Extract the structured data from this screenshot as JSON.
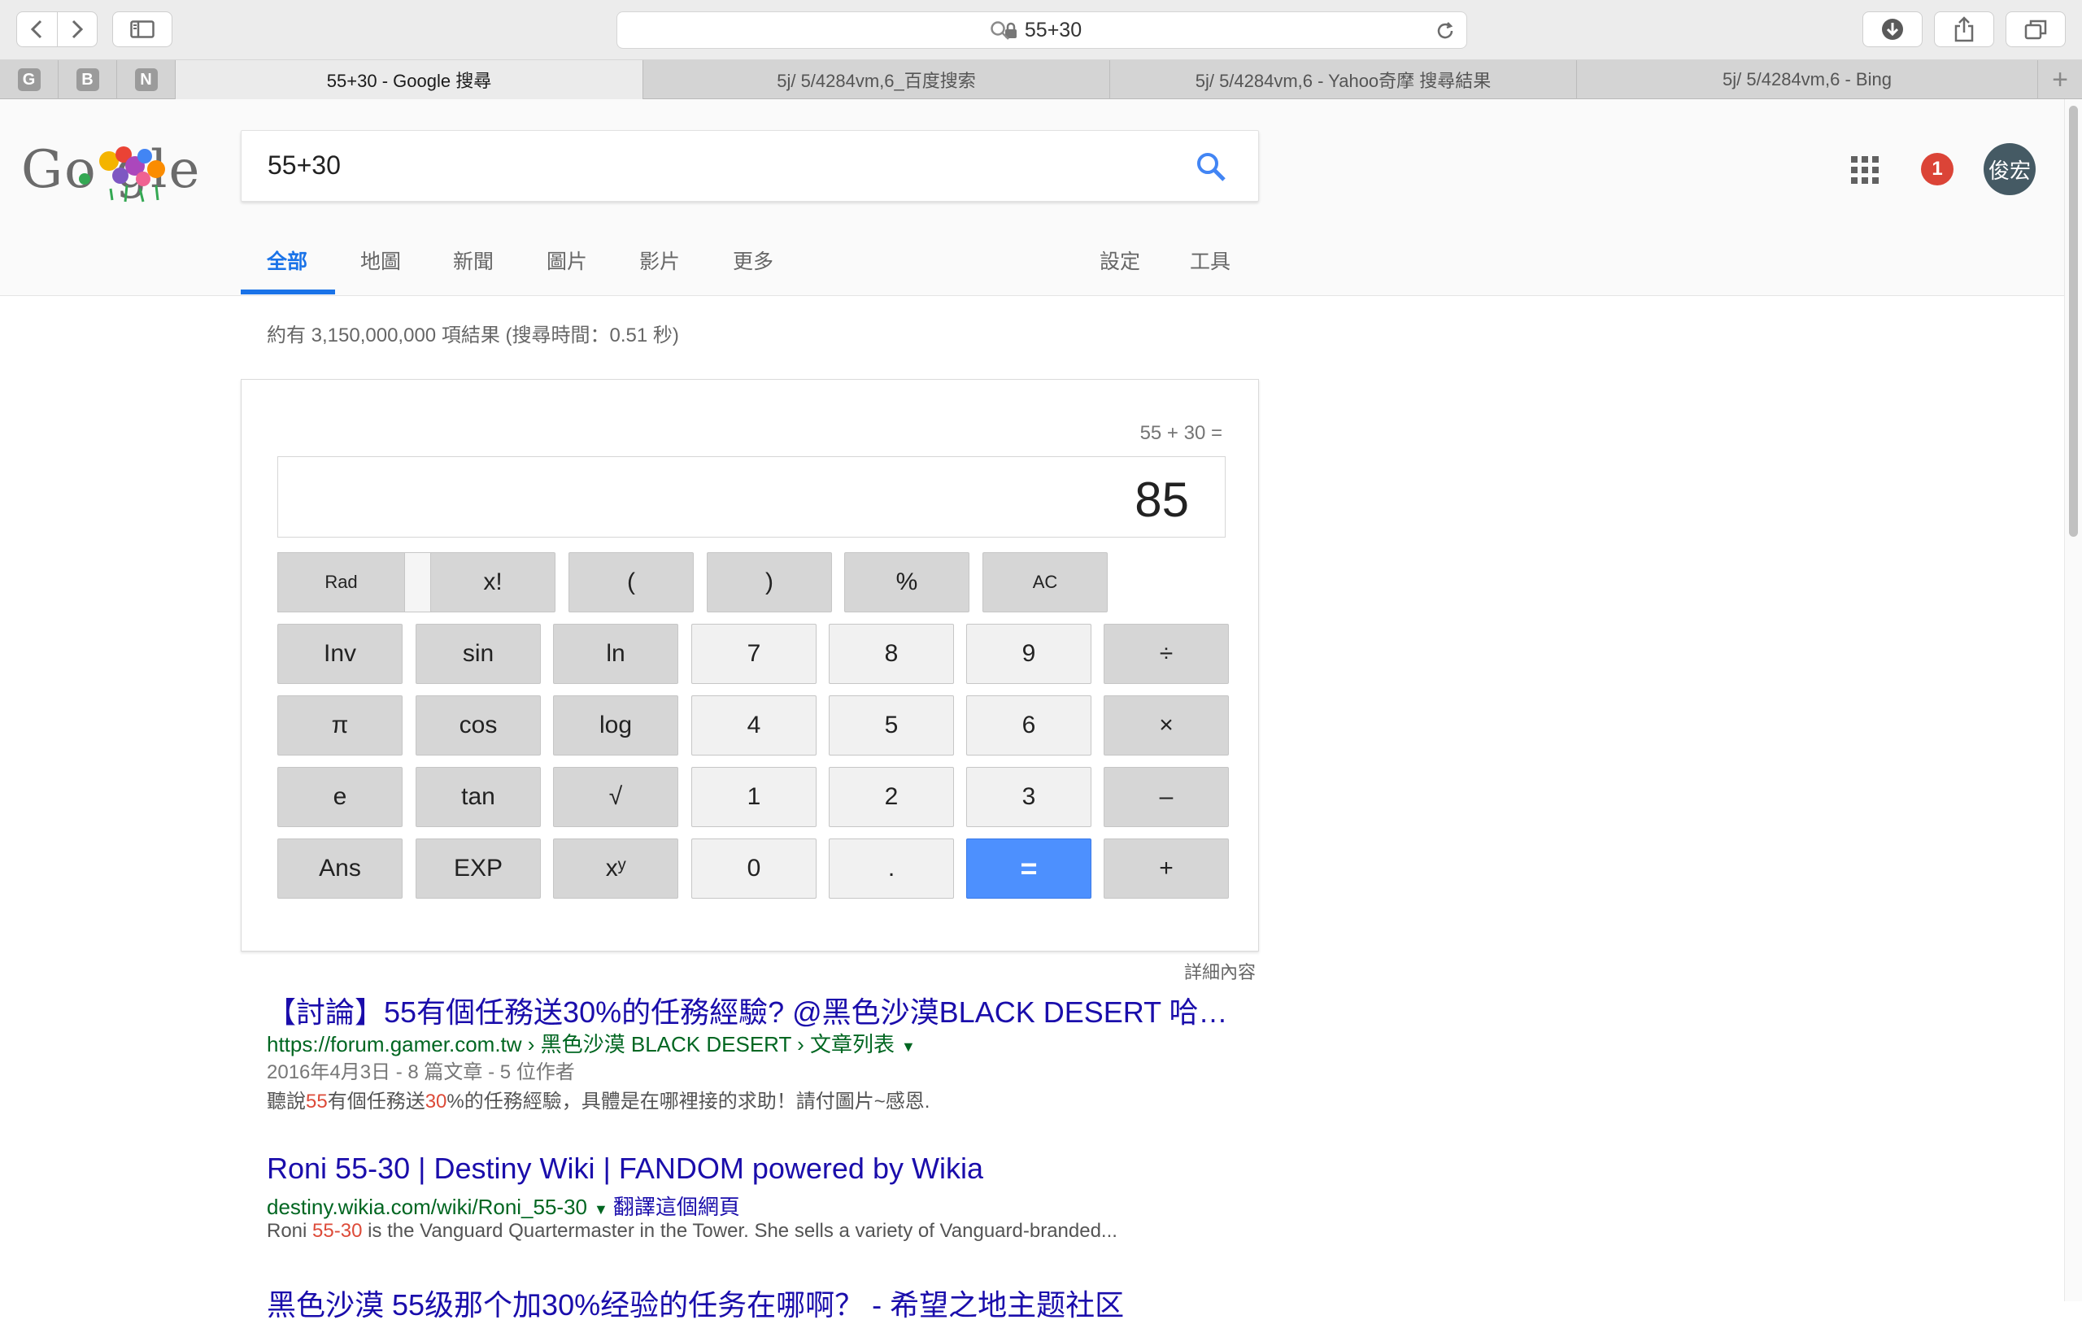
{
  "browser": {
    "url": "55+30",
    "tabs": [
      {
        "label": "55+30 - Google 搜尋",
        "active": true
      },
      {
        "label": "5j/ 5/4284vm,6_百度搜索",
        "active": false
      },
      {
        "label": "5j/ 5/4284vm,6 - Yahoo奇摩 搜尋結果",
        "active": false
      },
      {
        "label": "5j/ 5/4284vm,6 - Bing",
        "active": false
      }
    ],
    "pinned_tabs": [
      "G",
      "B",
      "N"
    ],
    "new_tab_symbol": "+"
  },
  "google": {
    "logo_text": "Go gle",
    "query": "55+30",
    "notification_count": "1",
    "avatar_text": "俊宏",
    "nav_tabs": [
      "全部",
      "地圖",
      "新聞",
      "圖片",
      "影片",
      "更多"
    ],
    "settings_label": "設定",
    "tools_label": "工具",
    "stats": "約有 3,150,000,000 項結果 (搜尋時間：0.51 秒)"
  },
  "calculator": {
    "expression": "55 + 30 =",
    "result": "85",
    "rad_label": "Rad",
    "keys": [
      [
        "x!",
        "(",
        ")",
        "%",
        "AC"
      ],
      [
        "Inv",
        "sin",
        "ln",
        "7",
        "8",
        "9",
        "÷"
      ],
      [
        "π",
        "cos",
        "log",
        "4",
        "5",
        "6",
        "×"
      ],
      [
        "e",
        "tan",
        "√",
        "1",
        "2",
        "3",
        "–"
      ],
      [
        "Ans",
        "EXP",
        "xʸ",
        "0",
        ".",
        "=",
        "+"
      ]
    ],
    "details_label": "詳細內容"
  },
  "results": [
    {
      "title": "【討論】55有個任務送30%的任務經驗? @黑色沙漠BLACK DESERT 哈…",
      "url": "https://forum.gamer.com.tw › 黑色沙漠 BLACK DESERT › 文章列表",
      "meta": "2016年4月3日 - 8 篇文章 - 5 位作者",
      "snippet_parts": [
        "聽說",
        "55",
        "有個任務送",
        "30",
        "%的任務經驗，具體是在哪裡接的求助！請付圖片~感恩."
      ]
    },
    {
      "title": "Roni 55-30 | Destiny Wiki | FANDOM powered by Wikia",
      "url": "destiny.wikia.com/wiki/Roni_55-30",
      "translate_label": "翻譯這個網頁",
      "snippet_parts": [
        "Roni ",
        "55-30",
        " is the Vanguard Quartermaster in the Tower. She sells a variety of Vanguard-branded..."
      ]
    },
    {
      "title": "黑色沙漠 55级那个加30%经验的任务在哪啊？ - 希望之地主题社区"
    }
  ]
}
